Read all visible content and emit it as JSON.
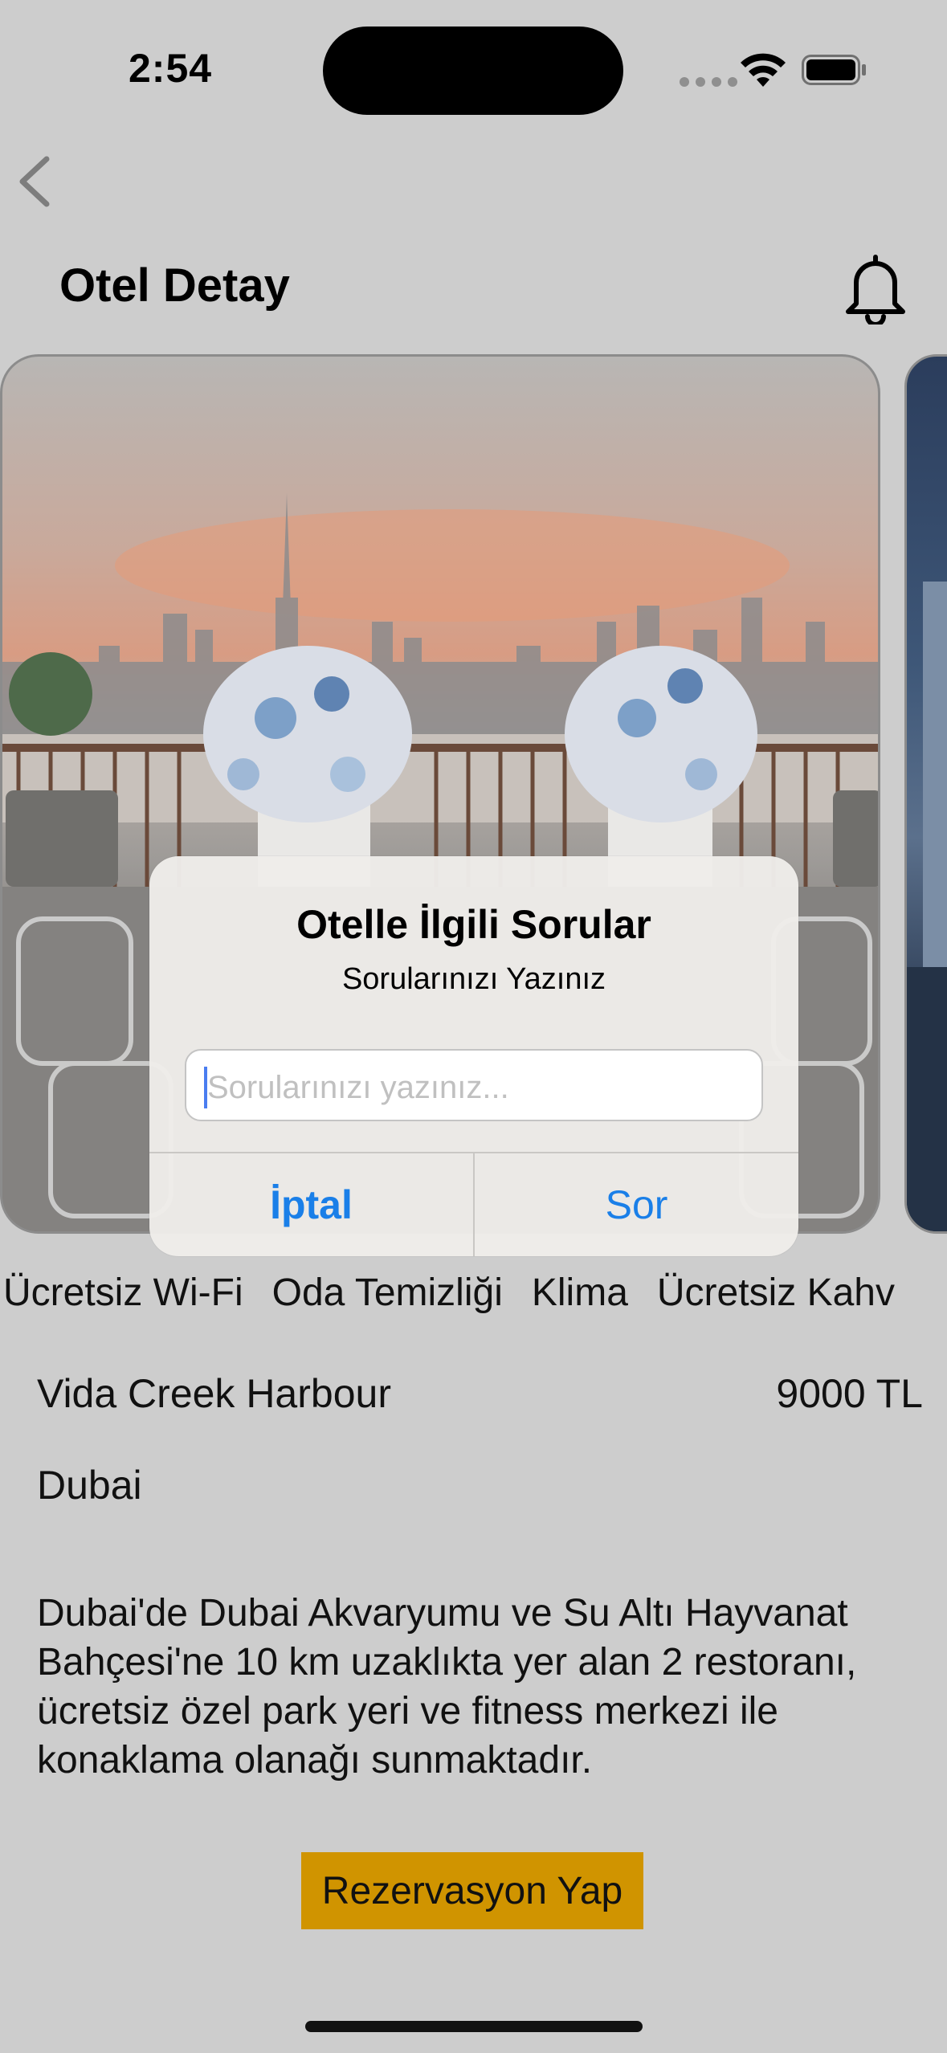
{
  "status_bar": {
    "time": "2:54"
  },
  "nav": {
    "title": "Otel Detay"
  },
  "amenities": [
    "Ücretsiz Wi-Fi",
    "Oda Temizliği",
    "Klima",
    "Ücretsiz Kahv"
  ],
  "hotel": {
    "name": "Vida Creek Harbour",
    "price": "9000 TL",
    "city": "Dubai",
    "description": "Dubai'de Dubai Akvaryumu ve Su Altı Hayvanat Bahçesi'ne 10 km uzaklıkta yer alan 2 restoranı, ücretsiz özel park yeri ve fitness merkezi ile konaklama olanağı sunmaktadır."
  },
  "reserve_button": "Rezervasyon Yap",
  "alert": {
    "title": "Otelle İlgili Sorular",
    "message": "Sorularınızı Yazınız",
    "input_placeholder": "Sorularınızı yazınız...",
    "cancel_label": "İptal",
    "ask_label": "Sor"
  },
  "colors": {
    "background": "#cdcdcd",
    "reserve_button": "#d09400",
    "alert_action": "#1a7fe8"
  }
}
